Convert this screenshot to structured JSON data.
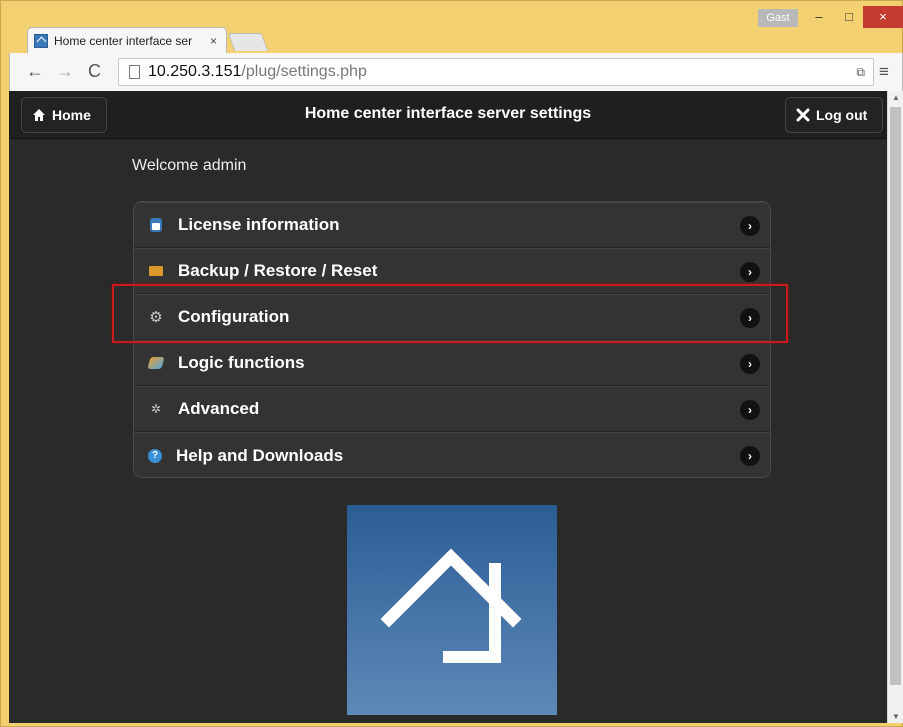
{
  "browser": {
    "tab_title": "Home center interface ser",
    "tab_close": "×",
    "profile_label": "Gast",
    "window_controls": {
      "minimize": "–",
      "maximize": "□",
      "close": "×"
    },
    "url_host": "10.250.3.151",
    "url_path": "/plug/settings.php",
    "nav": {
      "back": "←",
      "forward": "→",
      "reload": "C",
      "menu": "≡"
    }
  },
  "header": {
    "home_label": "Home",
    "title": "Home center interface server settings",
    "logout_label": "Log out"
  },
  "welcome_text": "Welcome admin",
  "menu": {
    "items": [
      {
        "label": "License information",
        "icon": "license-icon"
      },
      {
        "label": "Backup / Restore / Reset",
        "icon": "backup-icon"
      },
      {
        "label": "Configuration",
        "icon": "gear-icon"
      },
      {
        "label": "Logic functions",
        "icon": "logic-icon"
      },
      {
        "label": "Advanced",
        "icon": "gears-icon"
      },
      {
        "label": "Help and Downloads",
        "icon": "help-icon"
      }
    ],
    "highlighted_item": "Configuration"
  },
  "colors": {
    "background": "#2a2a2a",
    "header": "#1f1f1f",
    "highlight": "#cc1a1a",
    "logo_top": "#2b5d95",
    "logo_bottom": "#5d89b7"
  }
}
